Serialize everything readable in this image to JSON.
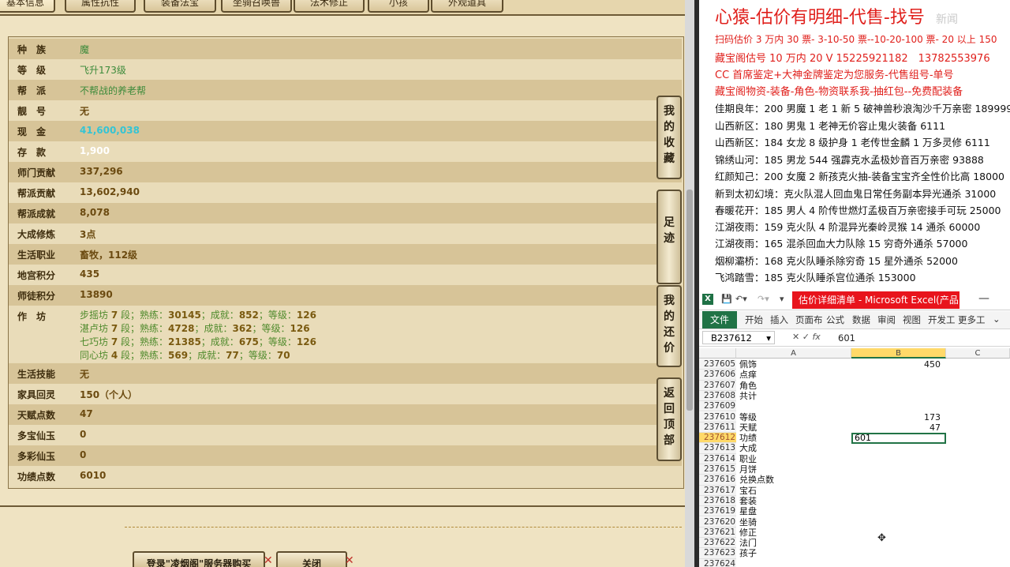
{
  "game": {
    "tabs": [
      "基本信息",
      "属性抗性",
      "装备法宝",
      "坐骑召唤兽",
      "法术修正",
      "小孩",
      "外观道具"
    ],
    "rows": [
      {
        "label": "种　族",
        "value": "魔",
        "style": "green"
      },
      {
        "label": "等　级",
        "value": "飞升173级",
        "style": "green"
      },
      {
        "label": "帮　派",
        "value": "不帮战的养老帮",
        "style": "green"
      },
      {
        "label": "靓　号",
        "value": "无",
        "style": "brown"
      },
      {
        "label": "现　金",
        "value": "41,600,038",
        "style": "cyan"
      },
      {
        "label": "存　款",
        "value": "1,900",
        "style": "white"
      },
      {
        "label": "师门贡献",
        "value": "337,296",
        "style": "brown"
      },
      {
        "label": "帮派贡献",
        "value": "13,602,940",
        "style": "brown"
      },
      {
        "label": "帮派成就",
        "value": "8,078",
        "style": "brown"
      },
      {
        "label": "大成修炼",
        "value": "3点",
        "style": "brown"
      },
      {
        "label": "生活职业",
        "value": "畜牧，112级",
        "style": "brown"
      },
      {
        "label": "地宫积分",
        "value": "435",
        "style": "brown"
      },
      {
        "label": "师徒积分",
        "value": "13890",
        "style": "brown"
      }
    ],
    "workshop_label": "作　坊",
    "workshops": [
      {
        "name": "步摇坊",
        "level": "7",
        "unit": "段；熟练：",
        "skill": "30145",
        "ach_label": "；成就：",
        "ach": "852",
        "lv_label": "；等级：",
        "lv": "126"
      },
      {
        "name": "湛卢坊",
        "level": "7",
        "unit": "段；熟练：",
        "skill": "4728",
        "ach_label": "；成就：",
        "ach": "362",
        "lv_label": "；等级：",
        "lv": "126"
      },
      {
        "name": "七巧坊",
        "level": "7",
        "unit": "段；熟练：",
        "skill": "21385",
        "ach_label": "；成就：",
        "ach": "675",
        "lv_label": "；等级：",
        "lv": "126"
      },
      {
        "name": "同心坊",
        "level": "4",
        "unit": "段；熟练：",
        "skill": "569",
        "ach_label": "；成就：",
        "ach": "77",
        "lv_label": "；等级：",
        "lv": "70"
      }
    ],
    "rows2": [
      {
        "label": "生活技能",
        "value": "无",
        "style": "brown"
      },
      {
        "label": "家具回灵",
        "value": "150（个人）",
        "style": "brown"
      },
      {
        "label": "天赋点数",
        "value": "47",
        "style": "brown"
      },
      {
        "label": "多宝仙玉",
        "value": "0",
        "style": "brown"
      },
      {
        "label": "多彩仙玉",
        "value": "0",
        "style": "brown"
      },
      {
        "label": "功绩点数",
        "value": "6010",
        "style": "brown"
      }
    ],
    "side_buttons": [
      {
        "chars": [
          "我",
          "的",
          "收",
          "藏"
        ]
      },
      {
        "chars": [
          "足",
          "迹"
        ]
      },
      {
        "chars": [
          "我",
          "的",
          "还",
          "价"
        ]
      },
      {
        "chars": [
          "返",
          "回",
          "顶",
          "部"
        ]
      }
    ],
    "bottom_buttons": [
      "登录\"凌烟阁\"服务器购买",
      "关闭"
    ]
  },
  "notes": {
    "title": "心猿-估价有明细-代售-找号",
    "watermark": "新闻",
    "red_lines": [
      "扫码估价 3 万内 30 票- 3-10-50 票--10-20-100 票- 20 以上 150",
      "藏宝阁估号 10 万内 20 V 15225921182　13782553976",
      "CC 首席鉴定+大神金牌鉴定为您服务-代售组号-单号",
      "藏宝阁物资-装备-角色-物资联系我-抽红包--免费配装备"
    ],
    "lines": [
      "佳期良年：200 男魔 1 老 1 新 5 破神兽秒浪淘沙千万亲密 189999",
      "山西新区：180 男鬼 1 老神无价容止鬼火装备 6111",
      "山西新区：184 女龙 8 级护身 1 老传世金麟 1 万多灵修 6111",
      "锦绣山河：185 男龙 544 强霹克水孟极妙音百万亲密 93888",
      "红颜知己：200 女魔 2 新孩克火抽-装备宝宝齐全性价比高 18000",
      "新到太初幻境：克火队混人回血鬼日常任务副本异光通杀 31000",
      "春暖花开：185 男人 4 阶传世燃灯孟极百万亲密接手可玩 25000",
      "江湖夜雨：159 克火队 4 阶混异光秦岭灵猴 14 通杀 60000",
      "江湖夜雨：165 混杀回血大力队除 15 穷奇外通杀 57000",
      "烟柳灞桥：168 克火队睡杀除穷奇 15 星外通杀 52000",
      "飞鸿踏雪：185 克火队睡杀宫位通杀 153000"
    ]
  },
  "excel": {
    "title": "估价详细清单 - Microsoft Excel(产品...",
    "tabs": [
      "开始",
      "插入",
      "页面布",
      "公式",
      "数据",
      "审阅",
      "视图",
      "开发工",
      "更多工"
    ],
    "file_tab": "文件",
    "name_box": "B237612",
    "formula_value": "601",
    "columns": [
      "A",
      "B",
      "C"
    ],
    "rows": [
      {
        "n": "237605",
        "a": "佩饰",
        "b": "450"
      },
      {
        "n": "237606",
        "a": "点痒",
        "b": ""
      },
      {
        "n": "237607",
        "a": "角色",
        "b": ""
      },
      {
        "n": "237608",
        "a": "共计",
        "b": ""
      },
      {
        "n": "237609",
        "a": "",
        "b": ""
      },
      {
        "n": "237610",
        "a": "等级",
        "b": "173"
      },
      {
        "n": "237611",
        "a": "天赋",
        "b": "47"
      },
      {
        "n": "237612",
        "a": "功绩",
        "b": "601"
      },
      {
        "n": "237613",
        "a": "大成",
        "b": ""
      },
      {
        "n": "237614",
        "a": "职业",
        "b": ""
      },
      {
        "n": "237615",
        "a": "月饼",
        "b": ""
      },
      {
        "n": "237616",
        "a": "兑换点数",
        "b": ""
      },
      {
        "n": "237617",
        "a": "宝石",
        "b": ""
      },
      {
        "n": "237618",
        "a": "套装",
        "b": ""
      },
      {
        "n": "237619",
        "a": "星盘",
        "b": ""
      },
      {
        "n": "237620",
        "a": "坐骑",
        "b": ""
      },
      {
        "n": "237621",
        "a": "修正",
        "b": ""
      },
      {
        "n": "237622",
        "a": "法门",
        "b": ""
      },
      {
        "n": "237623",
        "a": "孩子",
        "b": ""
      },
      {
        "n": "237624",
        "a": "",
        "b": ""
      }
    ]
  }
}
